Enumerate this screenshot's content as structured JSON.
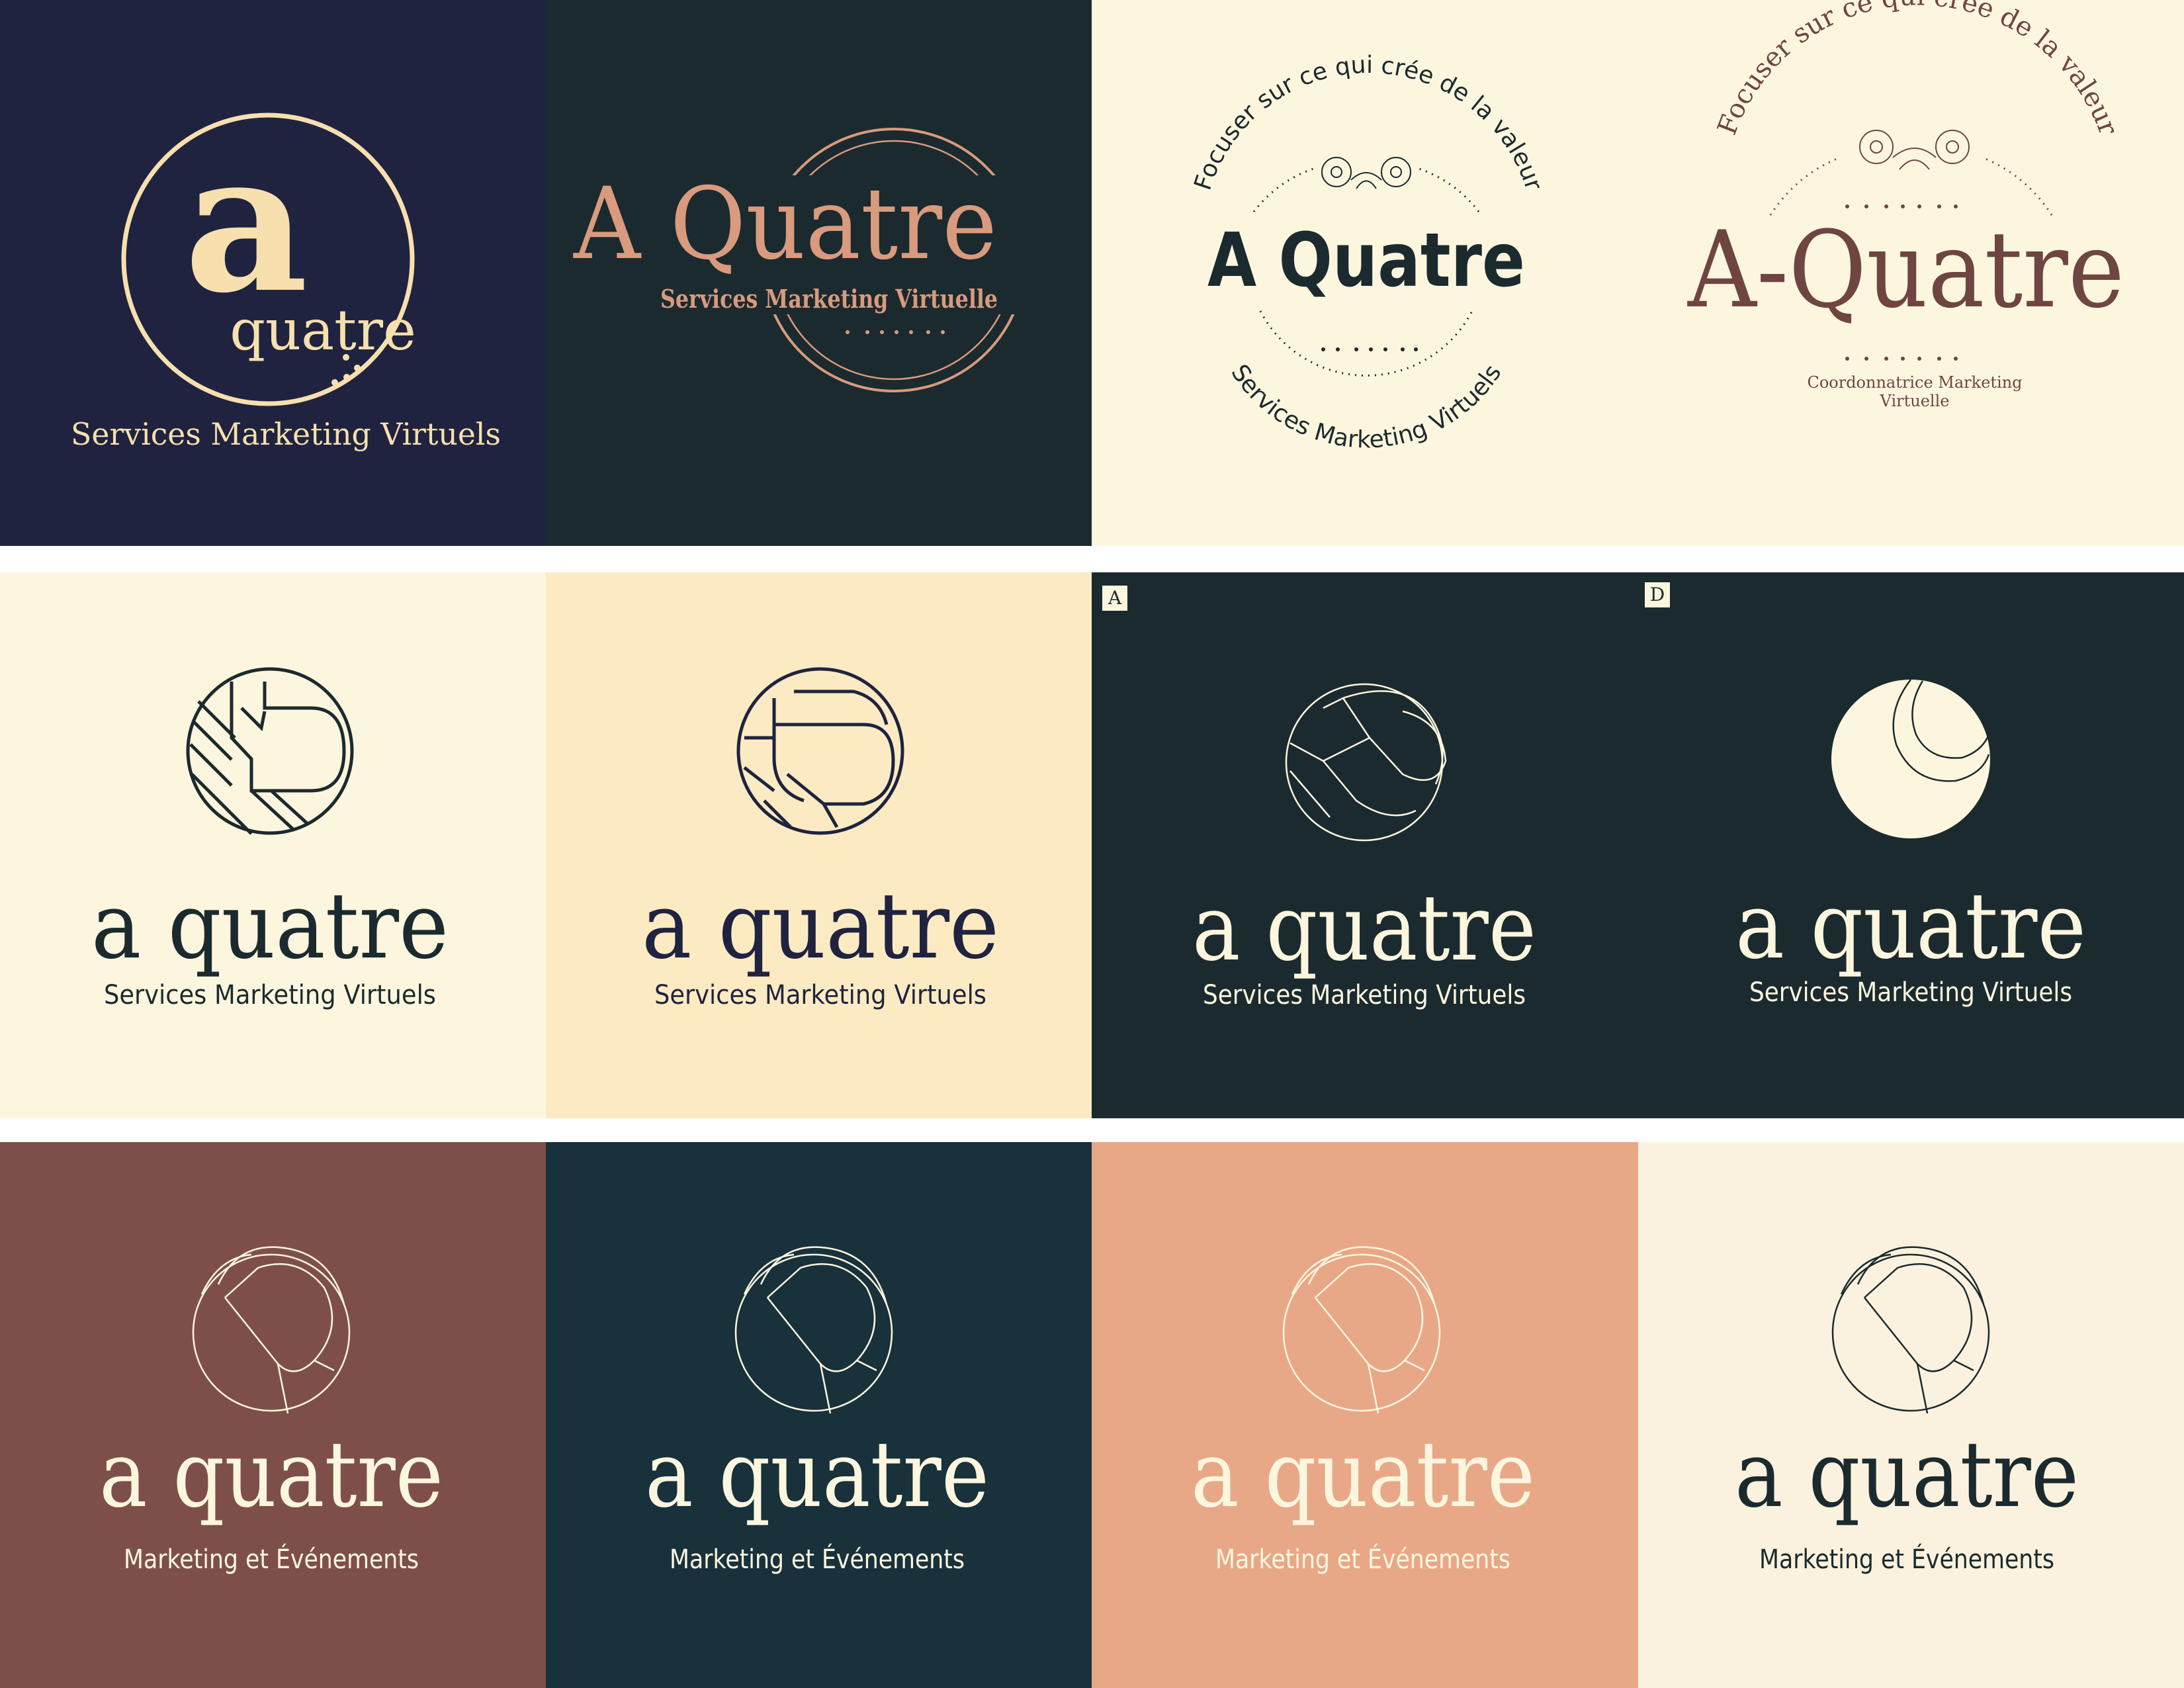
{
  "colors": {
    "navy": "#1f2340",
    "dark_teal": "#1b2a2e",
    "cream": "#fdf6df",
    "butter": "#fcebc2",
    "gold": "#f7e0ae",
    "copper": "#d99a7e",
    "brown": "#7e4f4a",
    "petrol": "#18313b",
    "salmon": "#e8a888",
    "cream_light": "#faf2de",
    "ink": "#1b2a2e",
    "brown_text": "#6f4541"
  },
  "tiles": [
    {
      "id": "t1",
      "mark": "a",
      "word": "quatre",
      "tagline": "Services Marketing Virtuels"
    },
    {
      "id": "t2",
      "wordmark": "A Quatre",
      "tagline": "Services Marketing Virtuelle"
    },
    {
      "id": "t3",
      "arc_top": "Focuser sur ce qui crée de la valeur",
      "wordmark": "A Quatre",
      "arc_bottom": "Services Marketing Virtuels"
    },
    {
      "id": "t4",
      "arc_top": "Focuser sur ce qui crée de la valeur",
      "wordmark": "A-Quatre",
      "tagline_1": "Coordonnatrice Marketing",
      "tagline_2": "Virtuelle"
    },
    {
      "id": "t5",
      "wordmark": "a quatre",
      "tagline": "Services Marketing Virtuels"
    },
    {
      "id": "t6",
      "wordmark": "a quatre",
      "tagline": "Services Marketing Virtuels"
    },
    {
      "id": "t7",
      "label": "A",
      "wordmark": "a quatre",
      "tagline": "Services Marketing Virtuels"
    },
    {
      "id": "t8",
      "label": "D",
      "wordmark": "a quatre",
      "tagline": "Services Marketing Virtuels"
    },
    {
      "id": "t9",
      "wordmark": "a quatre",
      "tagline": "Marketing et Événements"
    },
    {
      "id": "t10",
      "wordmark": "a quatre",
      "tagline": "Marketing et Événements"
    },
    {
      "id": "t11",
      "wordmark": "a quatre",
      "tagline": "Marketing et Événements"
    },
    {
      "id": "t12",
      "wordmark": "a quatre",
      "tagline": "Marketing et Événements"
    }
  ]
}
